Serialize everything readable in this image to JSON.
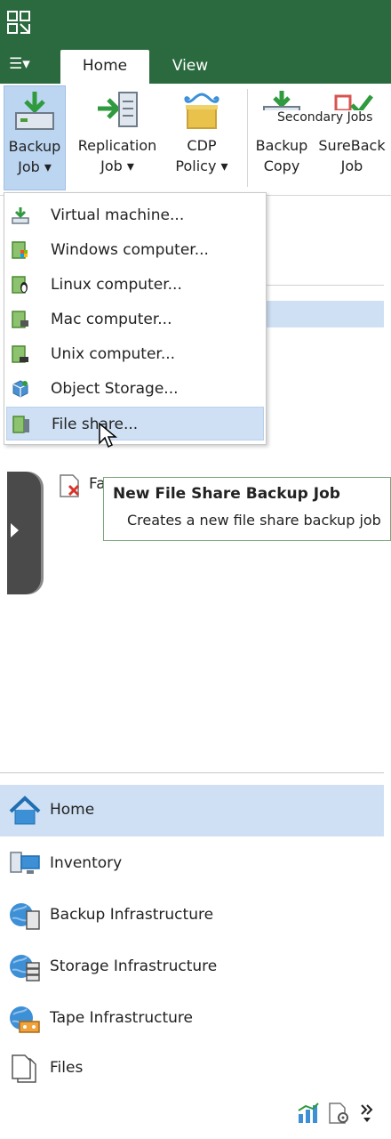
{
  "tabs": {
    "menu_label": "☰▾",
    "home": "Home",
    "view": "View"
  },
  "ribbon": {
    "buttons": [
      {
        "line1": "Backup",
        "line2": "Job ▾"
      },
      {
        "line1": "Replication",
        "line2": "Job ▾"
      },
      {
        "line1": "CDP",
        "line2": "Policy ▾"
      },
      {
        "line1": "Backup",
        "line2": "Copy"
      },
      {
        "line1": "SureBack",
        "line2": "Job"
      }
    ],
    "group_label": "Secondary Jobs"
  },
  "dropdown": {
    "items": [
      {
        "label": "Virtual machine...",
        "icon": "vm-download-icon"
      },
      {
        "label": "Windows computer...",
        "icon": "windows-computer-icon"
      },
      {
        "label": "Linux computer...",
        "icon": "linux-computer-icon"
      },
      {
        "label": "Mac computer...",
        "icon": "mac-computer-icon"
      },
      {
        "label": "Unix computer...",
        "icon": "unix-computer-icon"
      },
      {
        "label": "Object Storage...",
        "icon": "object-storage-icon"
      },
      {
        "label": "File share...",
        "icon": "file-share-icon"
      }
    ]
  },
  "tree": {
    "partial_label": "Fa"
  },
  "tooltip": {
    "title": "New File Share Backup Job",
    "description": "Creates a new file share backup job"
  },
  "nav": {
    "items": [
      {
        "label": "Home",
        "icon": "home-icon"
      },
      {
        "label": "Inventory",
        "icon": "inventory-icon"
      },
      {
        "label": "Backup Infrastructure",
        "icon": "backup-infrastructure-icon"
      },
      {
        "label": "Storage Infrastructure",
        "icon": "storage-infrastructure-icon"
      },
      {
        "label": "Tape Infrastructure",
        "icon": "tape-infrastructure-icon"
      },
      {
        "label": "Files",
        "icon": "files-icon"
      }
    ]
  },
  "colors": {
    "brand_green": "#2b6a3f",
    "selection_blue": "#cfe0f4",
    "tooltip_border": "#7aa57a"
  }
}
